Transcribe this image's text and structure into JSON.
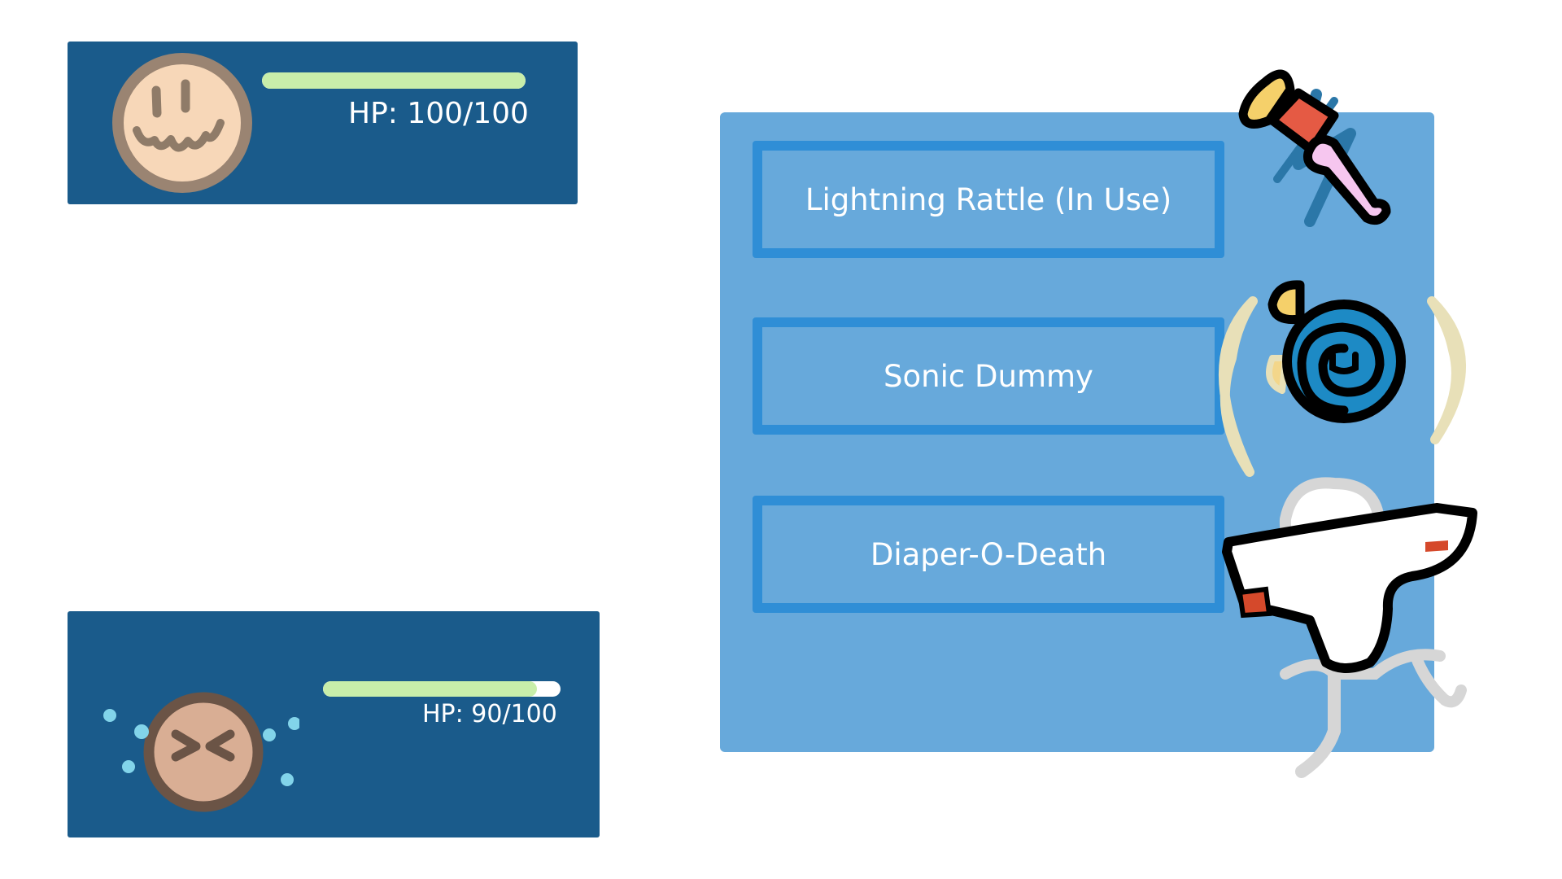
{
  "player": {
    "hp_label": "HP: 100/100",
    "hp_fraction": 1.0,
    "avatar_icon": "happy-face-icon"
  },
  "enemy": {
    "hp_label": "HP: 90/100",
    "hp_fraction": 0.9,
    "avatar_icon": "hurt-face-icon"
  },
  "menu": {
    "items": [
      {
        "label": "Lightning Rattle (In Use)",
        "icon": "lightning-rattle-icon"
      },
      {
        "label": "Sonic Dummy",
        "icon": "sonic-pacifier-icon"
      },
      {
        "label": "Diaper-O-Death",
        "icon": "diaper-icon"
      }
    ]
  },
  "colors": {
    "panel": "#1a5b8b",
    "hp_bar": "#c8eeaa",
    "hp_track": "#ffffff",
    "menu_bg": "#67a9db",
    "menu_button_border": "#2f8ed6",
    "text": "#ffffff"
  }
}
